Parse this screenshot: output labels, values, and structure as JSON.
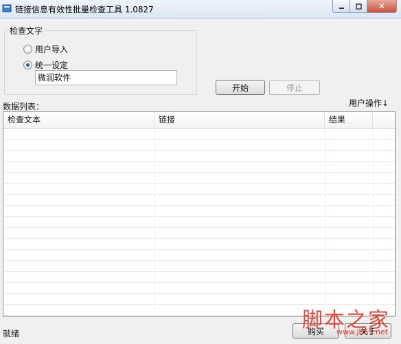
{
  "window": {
    "title": "链接信息有效性批量检查工具 1.0827",
    "close_glyph": "✕"
  },
  "check_text": {
    "legend": "检查文字",
    "options": [
      {
        "label": "用户导入",
        "checked": false
      },
      {
        "label": "统一设定",
        "checked": true
      }
    ],
    "value": "微润软件"
  },
  "actions": {
    "start_label": "开始",
    "stop_label": "停止"
  },
  "list": {
    "title": "数据列表：",
    "user_ops_label": "用户操作↓",
    "columns": [
      "检查文本",
      "链接",
      "结果"
    ]
  },
  "status": {
    "text": "就绪"
  },
  "footer_buttons": {
    "buy_label": "购买",
    "about_label": "关于"
  },
  "watermark": {
    "text": "脚本之家",
    "url": "www.jb51.net"
  },
  "colors": {
    "accent": "#2c5a9e",
    "watermark": "#e0392b"
  }
}
